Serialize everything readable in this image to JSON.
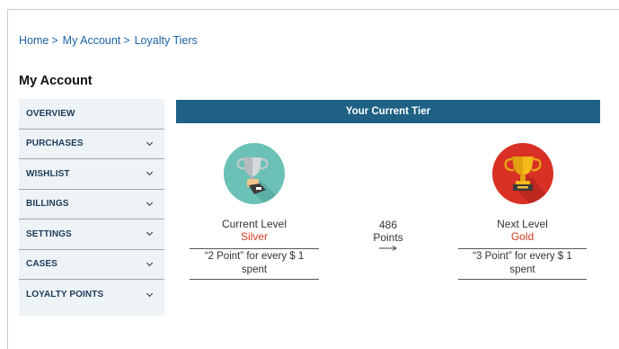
{
  "breadcrumb": {
    "items": [
      "Home",
      "My Account",
      "Loyalty Tiers"
    ],
    "separator": ">"
  },
  "account": {
    "title": "My Account"
  },
  "sidebar": {
    "items": [
      {
        "label": "OVERVIEW",
        "has_chevron": false
      },
      {
        "label": "PURCHASES",
        "has_chevron": true
      },
      {
        "label": "WISHLIST",
        "has_chevron": true
      },
      {
        "label": "BILLINGS",
        "has_chevron": true
      },
      {
        "label": "SETTINGS",
        "has_chevron": true
      },
      {
        "label": "CASES",
        "has_chevron": true
      },
      {
        "label": "LOYALTY POINTS",
        "has_chevron": true
      }
    ]
  },
  "tier": {
    "header": "Your Current Tier",
    "current": {
      "label": "Current Level",
      "value": "Silver",
      "desc": "“2 Point” for every $ 1 spent",
      "icon": "silver-trophy-icon"
    },
    "progress": {
      "points": "486",
      "unit": "Points"
    },
    "next": {
      "label": "Next Level",
      "value": "Gold",
      "desc": "“3 Point” for every $ 1 spent",
      "icon": "gold-trophy-icon"
    }
  },
  "colors": {
    "link": "#1e63a8",
    "header_bg": "#1e6185",
    "sidebar_bg": "#edf3f7",
    "accent_red": "#d33a22",
    "silver_circle": "#6cc1b6",
    "gold_circle": "#d93025"
  }
}
